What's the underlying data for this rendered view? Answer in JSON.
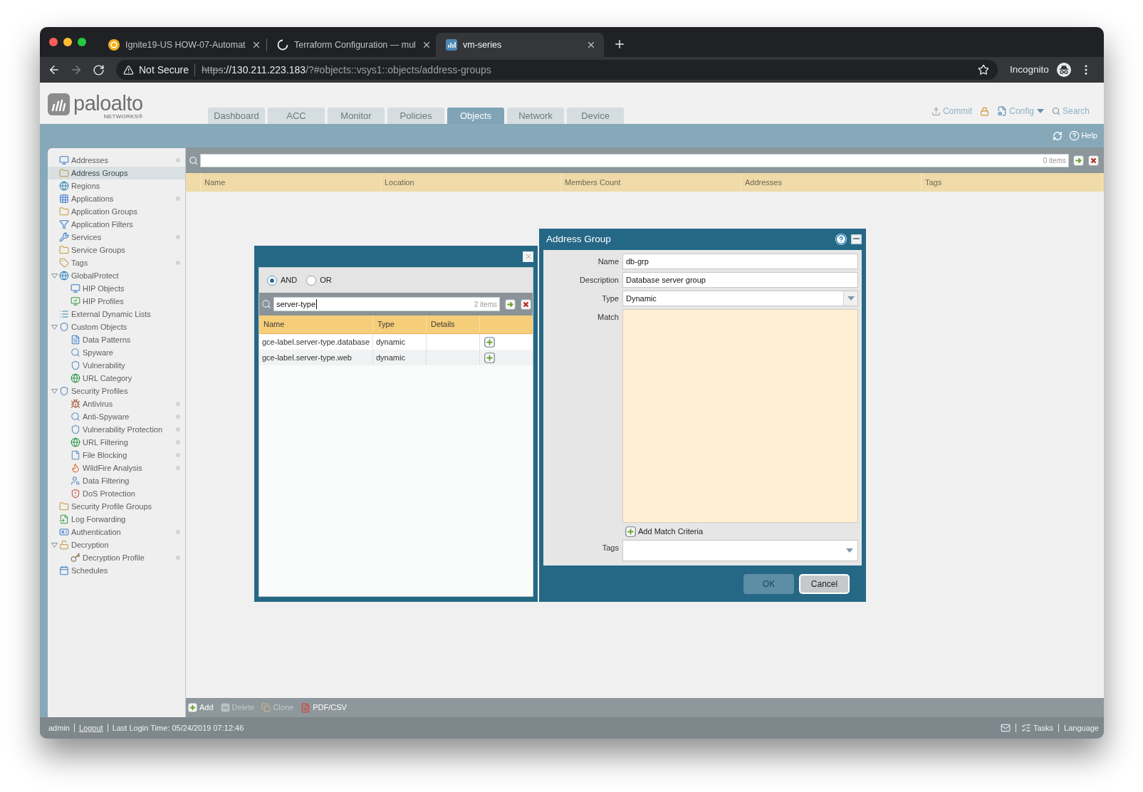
{
  "browser": {
    "tabs": [
      {
        "title": "Ignite19-US HOW-07-Automat",
        "selected": false
      },
      {
        "title": "Terraform Configuration — mul",
        "selected": false
      },
      {
        "title": "vm-series",
        "selected": true
      }
    ],
    "security_label": "Not Secure",
    "url": {
      "scheme": "https",
      "host": "://130.211.223.183",
      "path": "/?#objects::vsys1::objects/address-groups"
    },
    "profile_label": "Incognito"
  },
  "app_header": {
    "logo": {
      "wordmark": "paloalto",
      "tagline": "NETWORKS®"
    },
    "tabs": [
      {
        "label": "Dashboard",
        "selected": false
      },
      {
        "label": "ACC",
        "selected": false
      },
      {
        "label": "Monitor",
        "selected": false
      },
      {
        "label": "Policies",
        "selected": false
      },
      {
        "label": "Objects",
        "selected": true
      },
      {
        "label": "Network",
        "selected": false
      },
      {
        "label": "Device",
        "selected": false
      }
    ],
    "actions": [
      {
        "kind": "commit",
        "label": "Commit"
      },
      {
        "kind": "lock"
      },
      {
        "kind": "config",
        "label": "Config"
      },
      {
        "kind": "search",
        "label": "Search"
      }
    ]
  },
  "nav_bar": {
    "help_label": "Help"
  },
  "sidebar": {
    "items": [
      {
        "label": "Addresses",
        "selected": false,
        "indicator": true
      },
      {
        "label": "Address Groups",
        "selected": true,
        "indicator": false
      },
      {
        "label": "Regions",
        "selected": false,
        "indicator": false
      },
      {
        "label": "Applications",
        "selected": false,
        "indicator": true
      },
      {
        "label": "Application Groups",
        "selected": false,
        "indicator": false
      },
      {
        "label": "Application Filters",
        "selected": false,
        "indicator": false
      },
      {
        "label": "Services",
        "selected": false,
        "indicator": true
      },
      {
        "label": "Service Groups",
        "selected": false,
        "indicator": false
      },
      {
        "label": "Tags",
        "selected": false,
        "indicator": true
      },
      {
        "label": "GlobalProtect",
        "selected": false,
        "indicator": false,
        "expanded": true,
        "children": [
          {
            "label": "HIP Objects",
            "selected": false,
            "indicator": false
          },
          {
            "label": "HIP Profiles",
            "selected": false,
            "indicator": false
          }
        ]
      },
      {
        "label": "External Dynamic Lists",
        "selected": false,
        "indicator": false
      },
      {
        "label": "Custom Objects",
        "selected": false,
        "indicator": false,
        "expanded": true,
        "children": [
          {
            "label": "Data Patterns",
            "selected": false,
            "indicator": false
          },
          {
            "label": "Spyware",
            "selected": false,
            "indicator": false
          },
          {
            "label": "Vulnerability",
            "selected": false,
            "indicator": false
          },
          {
            "label": "URL Category",
            "selected": false,
            "indicator": false
          }
        ]
      },
      {
        "label": "Security Profiles",
        "selected": false,
        "indicator": false,
        "expanded": true,
        "children": [
          {
            "label": "Antivirus",
            "selected": false,
            "indicator": true
          },
          {
            "label": "Anti-Spyware",
            "selected": false,
            "indicator": true
          },
          {
            "label": "Vulnerability Protection",
            "selected": false,
            "indicator": true
          },
          {
            "label": "URL Filtering",
            "selected": false,
            "indicator": true
          },
          {
            "label": "File Blocking",
            "selected": false,
            "indicator": true
          },
          {
            "label": "WildFire Analysis",
            "selected": false,
            "indicator": true
          },
          {
            "label": "Data Filtering",
            "selected": false,
            "indicator": false
          },
          {
            "label": "DoS Protection",
            "selected": false,
            "indicator": false
          }
        ]
      },
      {
        "label": "Security Profile Groups",
        "selected": false,
        "indicator": false
      },
      {
        "label": "Log Forwarding",
        "selected": false,
        "indicator": false
      },
      {
        "label": "Authentication",
        "selected": false,
        "indicator": true
      },
      {
        "label": "Decryption",
        "selected": false,
        "indicator": false,
        "expanded": true,
        "children": [
          {
            "label": "Decryption Profile",
            "selected": false,
            "indicator": true
          }
        ]
      },
      {
        "label": "Schedules",
        "selected": false,
        "indicator": false
      }
    ]
  },
  "objects_table": {
    "search": {
      "count": "0 items"
    },
    "columns": [
      "Name",
      "Location",
      "Members Count",
      "Addresses",
      "Tags"
    ]
  },
  "tag_browser_dialog": {
    "match_options": [
      {
        "label": "AND",
        "selected": true
      },
      {
        "label": "OR",
        "selected": false
      }
    ],
    "search": {
      "value": "server-type",
      "count": "2 items"
    },
    "columns": [
      "Name",
      "Type",
      "Details"
    ],
    "rows": [
      {
        "name": "gce-label.server-type.database",
        "type": "dynamic"
      },
      {
        "name": "gce-label.server-type.web",
        "type": "dynamic"
      }
    ]
  },
  "address_group_dialog": {
    "title": "Address Group",
    "fields": [
      {
        "kind": "text",
        "label": "Name",
        "value": "db-grp"
      },
      {
        "kind": "text",
        "label": "Description",
        "value": "Database server group"
      },
      {
        "kind": "select",
        "label": "Type",
        "value": "Dynamic"
      },
      {
        "kind": "match",
        "label": "Match",
        "add_label": "Add Match Criteria"
      },
      {
        "kind": "tags",
        "label": "Tags"
      }
    ],
    "buttons": [
      {
        "label": "OK",
        "disabled": true
      },
      {
        "label": "Cancel",
        "disabled": false
      }
    ]
  },
  "bottom_toolbar": {
    "actions": [
      {
        "kind": "add",
        "label": "Add",
        "disabled": false
      },
      {
        "kind": "delete",
        "label": "Delete",
        "disabled": true
      },
      {
        "kind": "clone",
        "label": "Clone",
        "disabled": true
      },
      {
        "kind": "export",
        "label": "PDF/CSV",
        "disabled": false
      }
    ]
  },
  "status_bar": {
    "user": "admin",
    "logout": "Logout",
    "last_login": "Last Login Time: 05/24/2019 07:12:46",
    "tasks": "Tasks",
    "language": "Language"
  }
}
